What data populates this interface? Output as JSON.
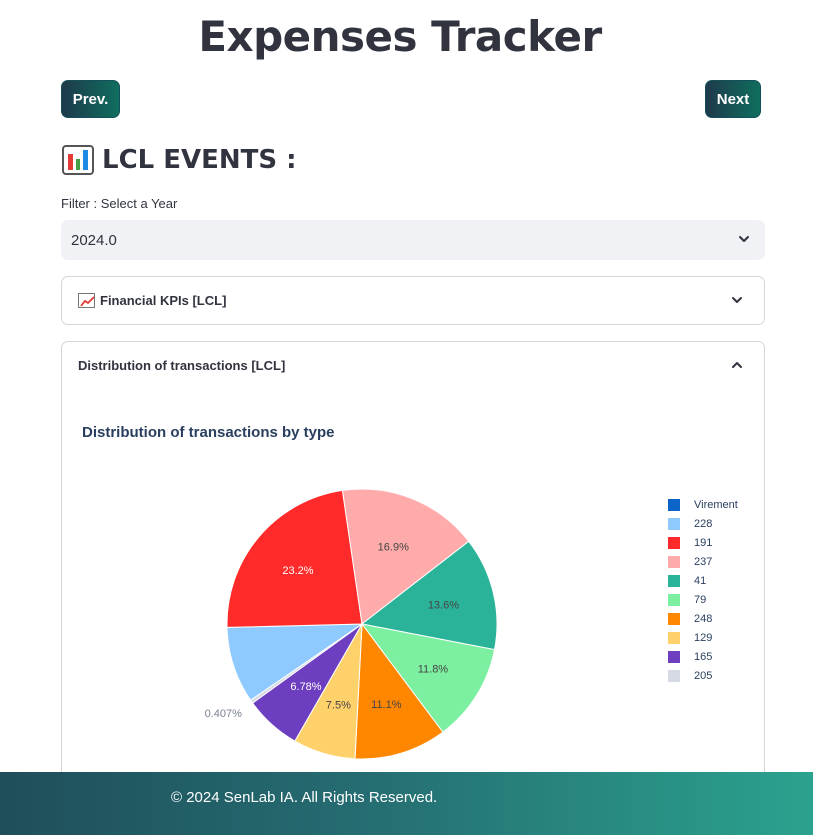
{
  "header": {
    "title": "Expenses Tracker"
  },
  "nav": {
    "prev_label": "Prev.",
    "next_label": "Next"
  },
  "section": {
    "title": "LCL EVENTS :",
    "icon": "bar-chart-icon"
  },
  "filter": {
    "label": "Filter : Select a Year",
    "value": "2024.0"
  },
  "expanders": [
    {
      "title": "Financial KPIs [LCL]",
      "icon": "chart-increasing-icon",
      "expanded": false
    },
    {
      "title": "Distribution of transactions [LCL]",
      "expanded": true
    }
  ],
  "chart_data": {
    "type": "pie",
    "title": "Distribution of transactions by type",
    "slices": [
      {
        "label": "Virement",
        "value": 0,
        "color": "#0d64c8",
        "text": ""
      },
      {
        "label": "228",
        "value": 9.2,
        "color": "#8ecaff",
        "text": ""
      },
      {
        "label": "191",
        "value": 23.2,
        "color": "#ff2b2b",
        "text": "23.2%"
      },
      {
        "label": "237",
        "value": 16.9,
        "color": "#ffabab",
        "text": "16.9%"
      },
      {
        "label": "41",
        "value": 13.6,
        "color": "#2bb39a",
        "text": "13.6%"
      },
      {
        "label": "79",
        "value": 11.8,
        "color": "#7defa1",
        "text": "11.8%"
      },
      {
        "label": "248",
        "value": 11.1,
        "color": "#ff8700",
        "text": "11.1%"
      },
      {
        "label": "129",
        "value": 7.5,
        "color": "#ffd16a",
        "text": "7.5%"
      },
      {
        "label": "165",
        "value": 6.78,
        "color": "#6d3fc0",
        "text": "6.78%"
      },
      {
        "label": "205",
        "value": 0.407,
        "color": "#d5dae5",
        "text": "0.407%"
      }
    ],
    "legend_position": "right"
  },
  "footer": {
    "text": "© 2024 SenLab IA. All Rights Reserved."
  }
}
